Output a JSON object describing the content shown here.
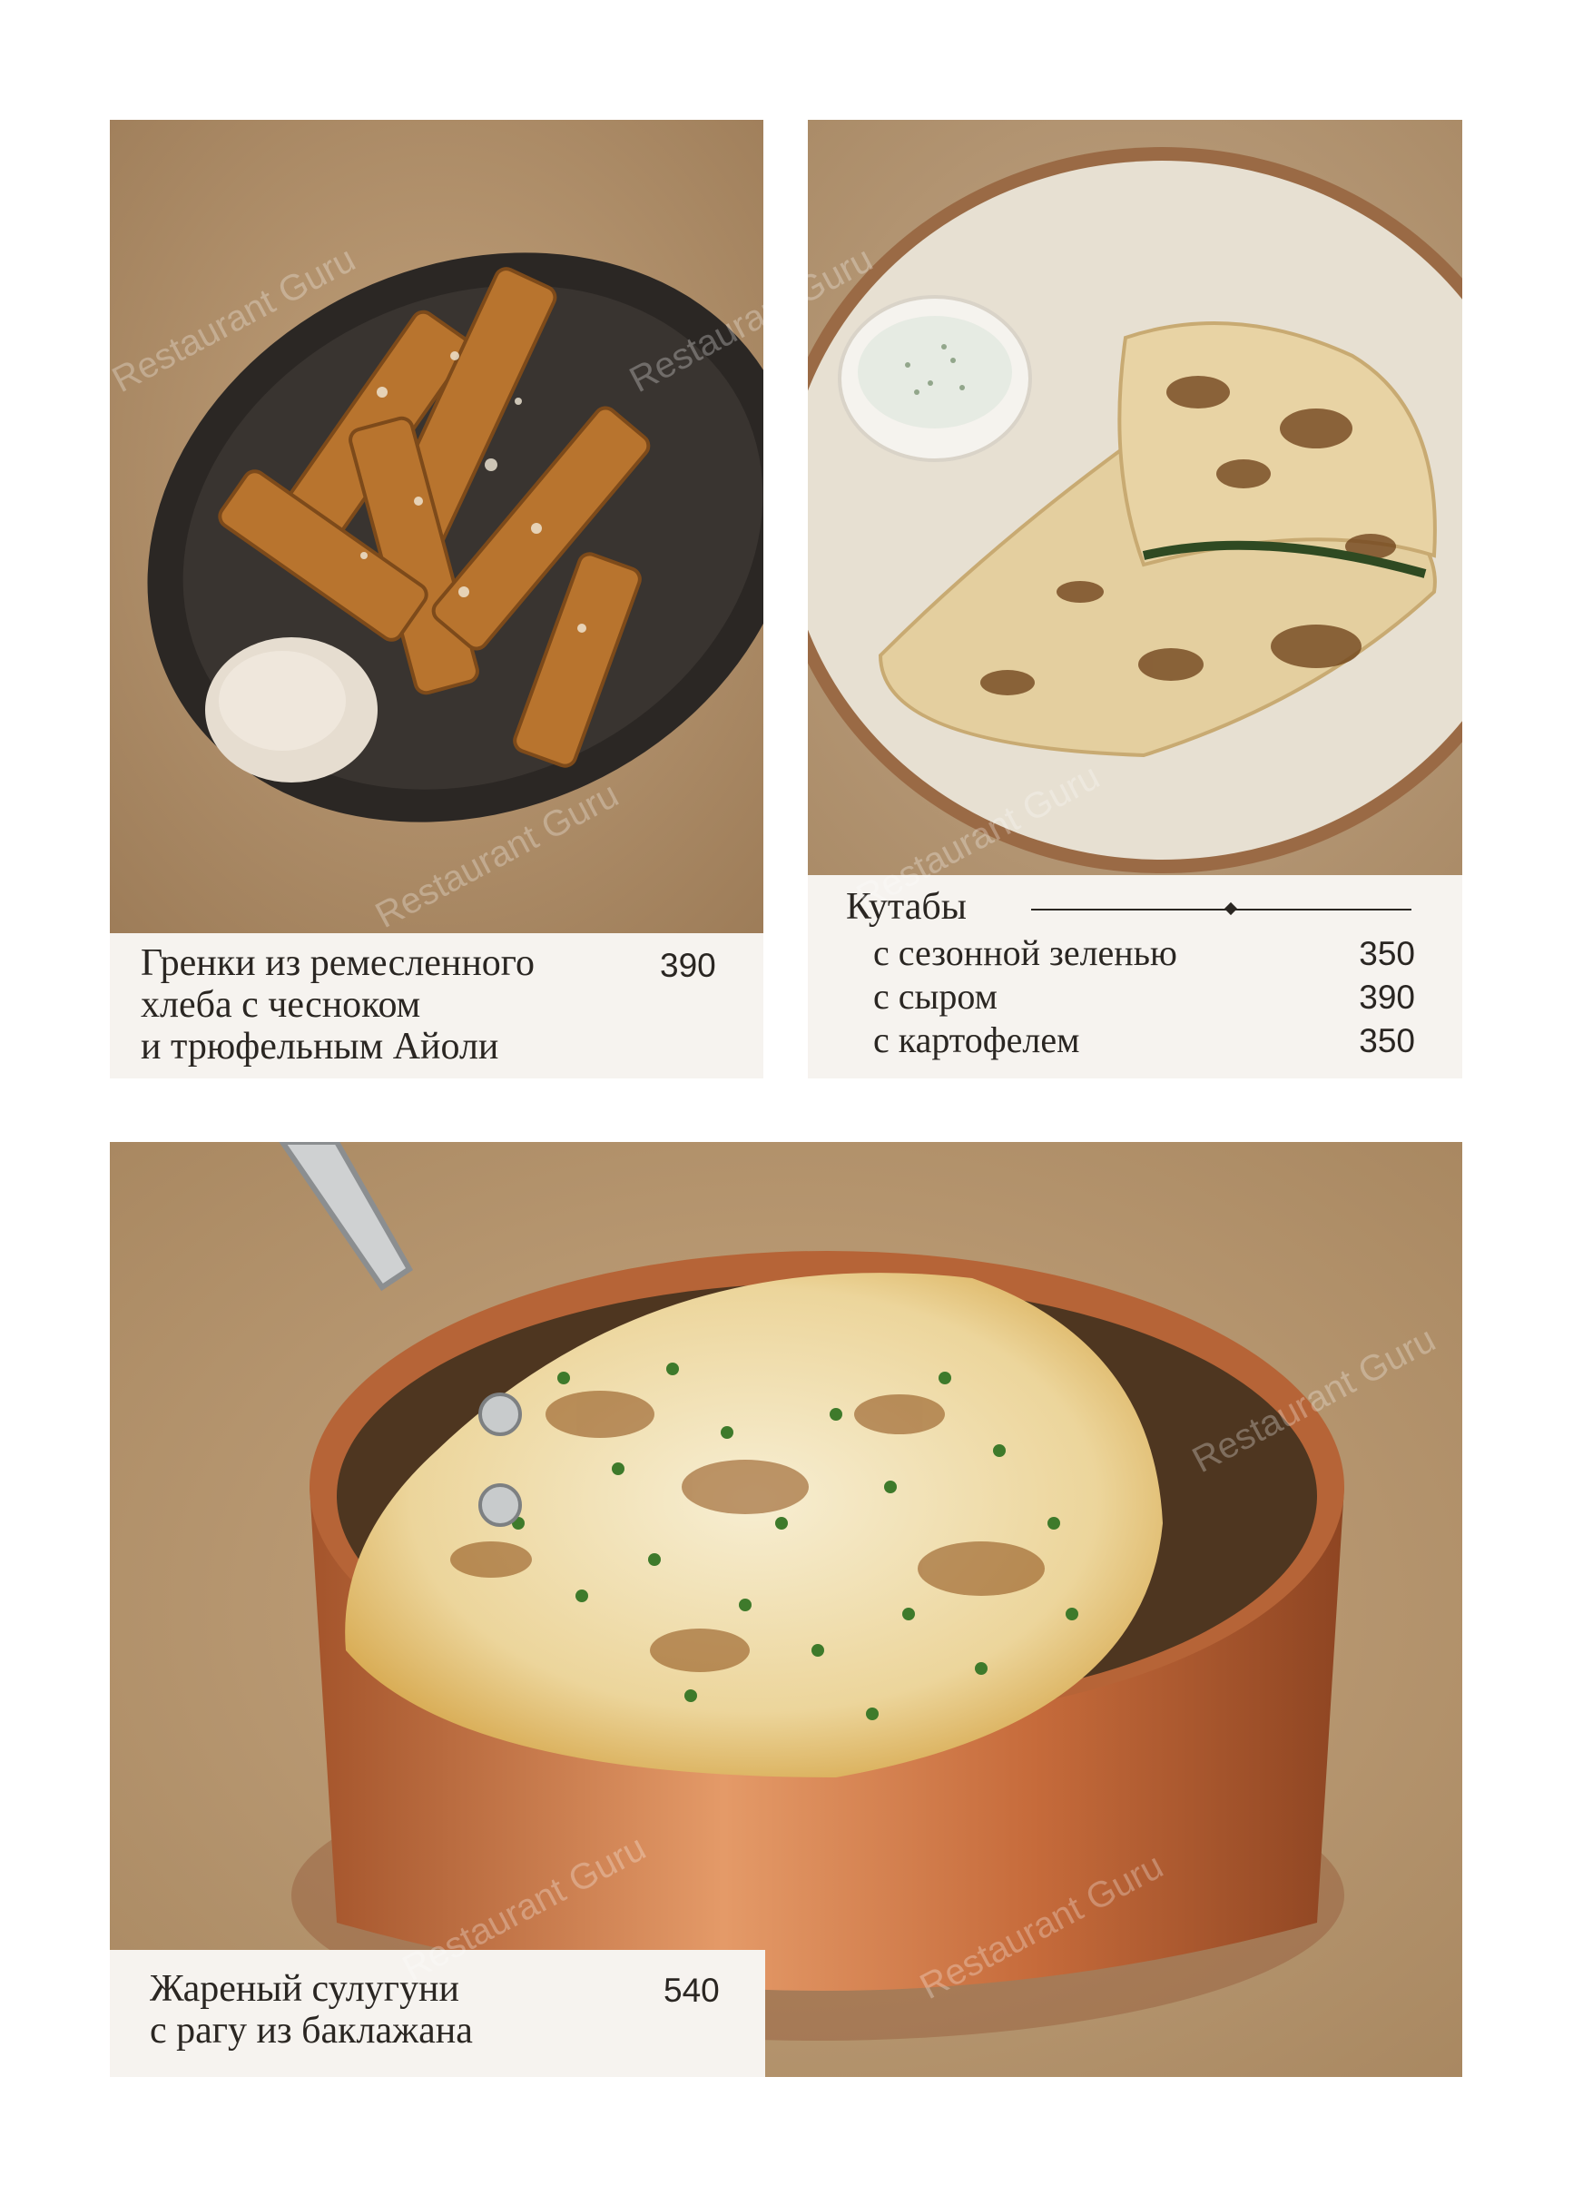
{
  "watermark": "Restaurant Guru",
  "cards": {
    "croutons": {
      "name_lines": [
        "Гренки из ремесленного",
        "хлеба с чесноком",
        "и трюфельным Айоли"
      ],
      "price": "390"
    },
    "kutaby": {
      "title": "Кутабы",
      "variants": [
        {
          "name": "с сезонной зеленью",
          "price": "350"
        },
        {
          "name": "с сыром",
          "price": "390"
        },
        {
          "name": "с картофелем",
          "price": "350"
        }
      ]
    },
    "suluguni": {
      "name_lines": [
        "Жареный сулугуни",
        "с рагу из баклажана"
      ],
      "price": "540"
    }
  },
  "colors": {
    "background": "#ffffff",
    "caption_bg": "#f6f3ef",
    "text": "#2a2622",
    "table_surface": "#b99a76"
  }
}
